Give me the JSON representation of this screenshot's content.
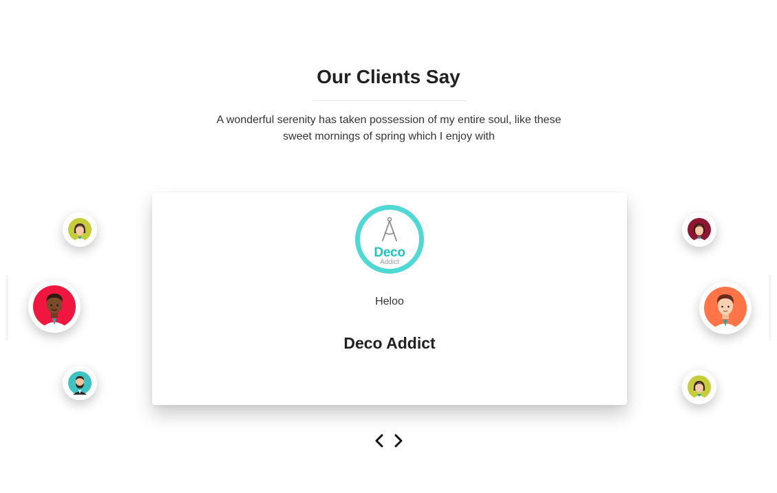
{
  "section": {
    "title": "Our Clients Say",
    "intro": "A wonderful serenity has taken possession of my entire soul, like these sweet mornings of spring which I enjoy with"
  },
  "testimonial": {
    "logo_main_text": "Deco",
    "logo_sub_text": "Addict",
    "quote": "Heloo",
    "client_name": "Deco Addict"
  },
  "colors": {
    "logo_ring": "#4fd9d4",
    "logo_text": "#20c4bd",
    "avatar_lime": "#c5cd3a",
    "avatar_red": "#f0163f",
    "avatar_teal": "#3dc3c2",
    "avatar_maroon": "#8e1630",
    "avatar_orange": "#ff7547"
  },
  "avatars": [
    {
      "name": "client-avatar-left-top",
      "icon": "woman-avatar-icon",
      "bg": "lime"
    },
    {
      "name": "client-avatar-left-middle",
      "icon": "man-avatar-icon",
      "bg": "red"
    },
    {
      "name": "client-avatar-left-bottom",
      "icon": "bearded-man-avatar-icon",
      "bg": "teal"
    },
    {
      "name": "client-avatar-right-top",
      "icon": "woman-avatar-icon",
      "bg": "maroon"
    },
    {
      "name": "client-avatar-right-middle",
      "icon": "man-avatar-icon",
      "bg": "orange"
    },
    {
      "name": "client-avatar-right-bottom",
      "icon": "woman-avatar-icon",
      "bg": "lime"
    }
  ],
  "navigation": {
    "prev_icon": "chevron-left-icon",
    "next_icon": "chevron-right-icon"
  }
}
